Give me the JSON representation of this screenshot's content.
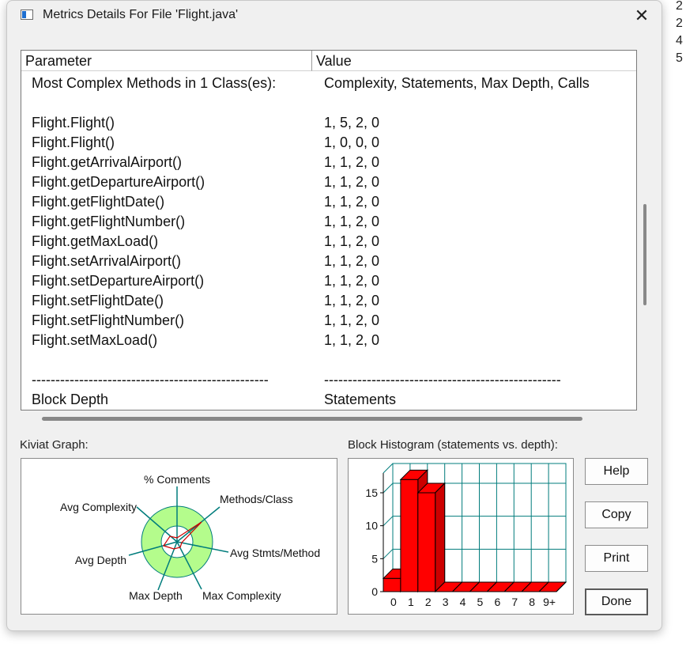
{
  "window": {
    "title": "Metrics Details For File 'Flight.java'"
  },
  "side_numbers": [
    "2",
    "2",
    "4",
    "5"
  ],
  "table": {
    "headers": {
      "parameter": "Parameter",
      "value": "Value"
    },
    "summary": {
      "parameter": "Most Complex Methods in 1 Class(es):",
      "value": "Complexity, Statements, Max Depth, Calls"
    },
    "rows": [
      {
        "method": "Flight.Flight()",
        "value": "1, 5, 2, 0"
      },
      {
        "method": "Flight.Flight()",
        "value": "1, 0, 0, 0"
      },
      {
        "method": "Flight.getArrivalAirport()",
        "value": "1, 1, 2, 0"
      },
      {
        "method": "Flight.getDepartureAirport()",
        "value": "1, 1, 2, 0"
      },
      {
        "method": "Flight.getFlightDate()",
        "value": "1, 1, 2, 0"
      },
      {
        "method": "Flight.getFlightNumber()",
        "value": "1, 1, 2, 0"
      },
      {
        "method": "Flight.getMaxLoad()",
        "value": "1, 1, 2, 0"
      },
      {
        "method": "Flight.setArrivalAirport()",
        "value": "1, 1, 2, 0"
      },
      {
        "method": "Flight.setDepartureAirport()",
        "value": "1, 1, 2, 0"
      },
      {
        "method": "Flight.setFlightDate()",
        "value": "1, 1, 2, 0"
      },
      {
        "method": "Flight.setFlightNumber()",
        "value": "1, 1, 2, 0"
      },
      {
        "method": "Flight.setMaxLoad()",
        "value": "1, 1, 2, 0"
      }
    ],
    "separator": {
      "parameter": "--------------------------------------------------",
      "value": "--------------------------------------------------"
    },
    "footer": {
      "parameter": "Block Depth",
      "value": "Statements"
    }
  },
  "kiviat": {
    "label": "Kiviat Graph:",
    "axes": [
      "% Comments",
      "Methods/Class",
      "Avg Stmts/Method",
      "Max Complexity",
      "Max Depth",
      "Avg Depth",
      "Avg Complexity"
    ],
    "ring_color": "#b4fc8c"
  },
  "histogram": {
    "label": "Block Histogram (statements vs. depth):",
    "bar_color": "#ff0000",
    "grid_color": "#007c7c"
  },
  "chart_data": {
    "type": "bar",
    "title": "Block Histogram (statements vs. depth):",
    "categories": [
      "0",
      "1",
      "2",
      "3",
      "4",
      "5",
      "6",
      "7",
      "8",
      "9+"
    ],
    "values": [
      2,
      17,
      15,
      0,
      0,
      0,
      0,
      0,
      0,
      0
    ],
    "y_ticks": [
      "0",
      "5",
      "10",
      "15"
    ],
    "ylim": [
      0,
      18
    ],
    "grid": true
  },
  "buttons": {
    "help": "Help",
    "copy": "Copy",
    "print": "Print",
    "done": "Done"
  }
}
